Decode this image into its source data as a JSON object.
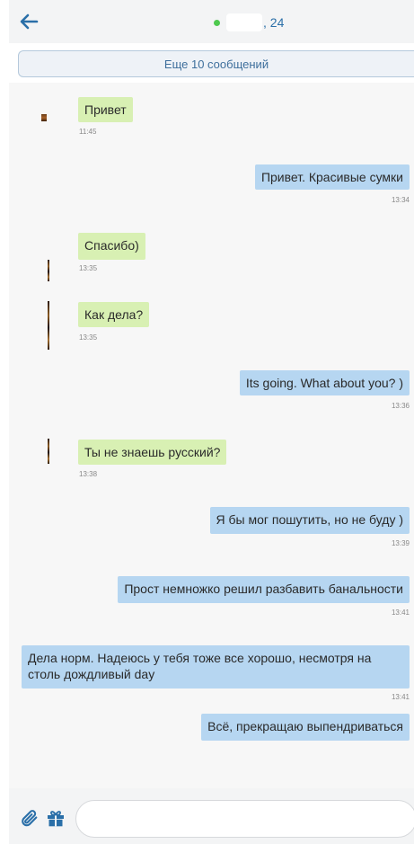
{
  "header": {
    "back_icon": "arrow-left-icon",
    "status_color": "#4ec94e",
    "title_suffix": ", 24"
  },
  "load_more_label": "Еще 10 сообщений",
  "messages": [
    {
      "dir": "in",
      "text": "Привет",
      "time": "11:45"
    },
    {
      "dir": "out",
      "text": "Привет. Красивые сумки",
      "time": "13:34"
    },
    {
      "dir": "in",
      "text": "Спасибо)",
      "time": "13:35"
    },
    {
      "dir": "in",
      "text": "Как дела?",
      "time": "13:35"
    },
    {
      "dir": "out",
      "text": "Its going. What about you? )",
      "time": "13:36"
    },
    {
      "dir": "in",
      "text": "Ты не знаешь русский?",
      "time": "13:38"
    },
    {
      "dir": "out",
      "text": "Я бы мог пошутить, но не буду )",
      "time": "13:39"
    },
    {
      "dir": "out",
      "text": "Прост немножко решил разбавить банальности",
      "time": "13:41"
    },
    {
      "dir": "out",
      "text": "Дела норм. Надеюсь у тебя тоже все хорошо, несмотря на столь дождливый day",
      "time": "13:41"
    },
    {
      "dir": "out",
      "text": "Всё, прекращаю выпендриваться",
      "time": ""
    }
  ],
  "footer": {
    "attach_icon": "paperclip-icon",
    "gift_icon": "gift-icon",
    "input_value": "",
    "input_placeholder": ""
  },
  "colors": {
    "incoming_bubble": "#d8f0b3",
    "outgoing_bubble": "#b6d6f1",
    "accent": "#2a6fa8"
  }
}
